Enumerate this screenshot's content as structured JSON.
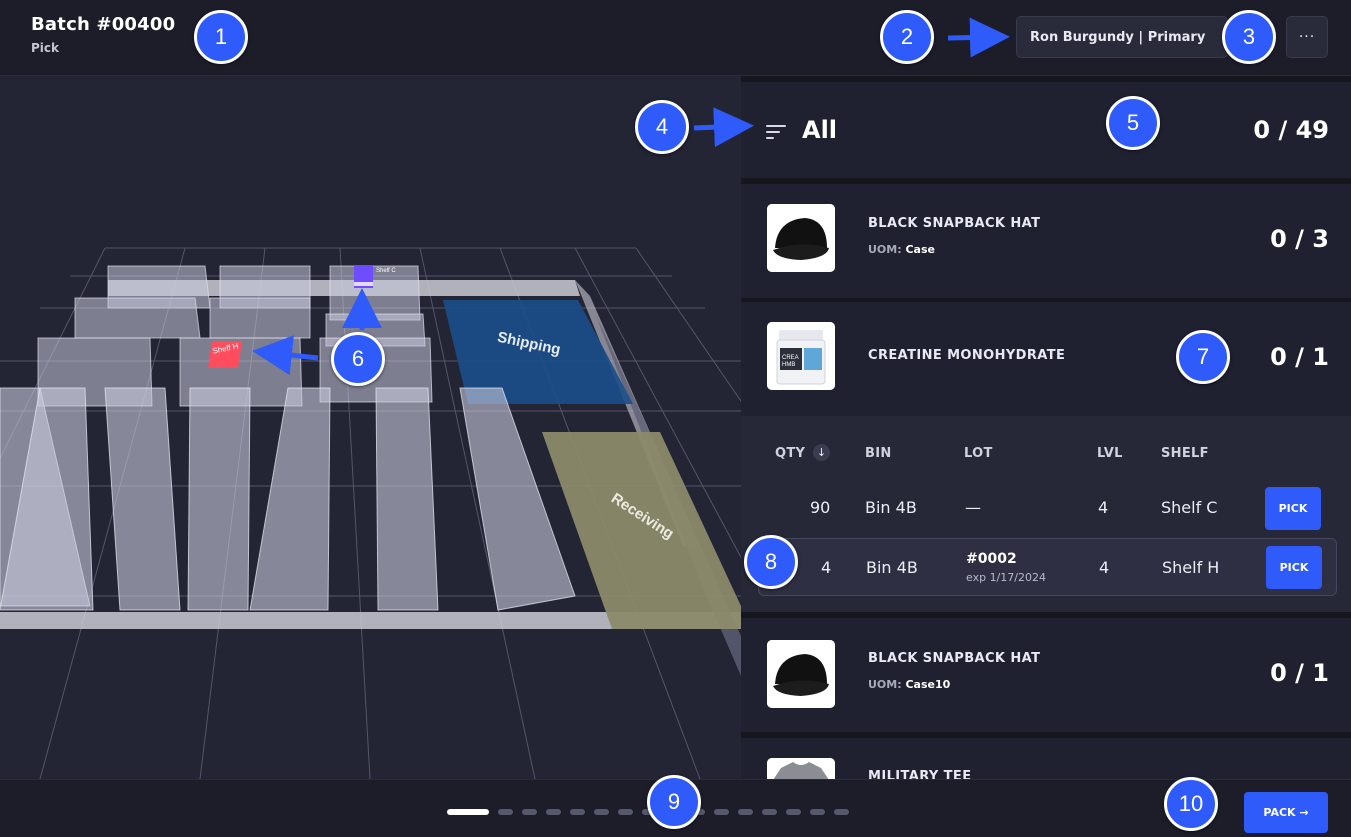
{
  "header": {
    "title": "Batch #00400",
    "subtitle": "Pick",
    "user_label": "Ron Burgundy | Primary",
    "more_label": "···"
  },
  "map": {
    "zones": {
      "shipping": "Shipping",
      "receiving": "Receiving"
    },
    "markers": {
      "shelf_c": "Shelf C",
      "shelf_h": "Shelf H"
    },
    "colors": {
      "shipping": "#1a4f8a",
      "receiving": "#8c8a6a",
      "target_shelf": "#ff4d5e",
      "current_shelf": "#6d4dff"
    }
  },
  "filter": {
    "label": "All",
    "count": "0 / 49"
  },
  "items": [
    {
      "name": "BLACK SNAPBACK HAT",
      "uom_label": "UOM:",
      "uom_value": "Case",
      "count": "0 / 3",
      "image": "black-cap-photo"
    },
    {
      "name": "CREATINE MONOHYDRATE",
      "count": "0 / 1",
      "image": "creatine-tub-photo"
    },
    {
      "name": "BLACK SNAPBACK HAT",
      "uom_label": "UOM:",
      "uom_value": "Case10",
      "count": "0 / 1",
      "image": "black-cap-photo"
    },
    {
      "name": "MILITARY TEE",
      "image": "gray-tee-photo"
    }
  ],
  "bins": {
    "headers": {
      "qty": "QTY",
      "bin": "BIN",
      "lot": "LOT",
      "lvl": "LVL",
      "shelf": "SHELF"
    },
    "sort_icon": "↓",
    "rows": [
      {
        "qty": "90",
        "bin": "Bin 4B",
        "lot": "—",
        "lvl": "4",
        "shelf": "Shelf C",
        "action": "PICK"
      },
      {
        "qty": "4",
        "bin": "Bin 4B",
        "lot": "#0002",
        "exp": "exp 1/17/2024",
        "lvl": "4",
        "shelf": "Shelf H",
        "action": "PICK"
      }
    ]
  },
  "footer": {
    "pack_label": "PACK →",
    "steps_total": 16,
    "step_active": 1
  },
  "callouts": [
    "1",
    "2",
    "3",
    "4",
    "5",
    "6",
    "7",
    "8",
    "9",
    "10"
  ],
  "accent": "#2f5bfb"
}
